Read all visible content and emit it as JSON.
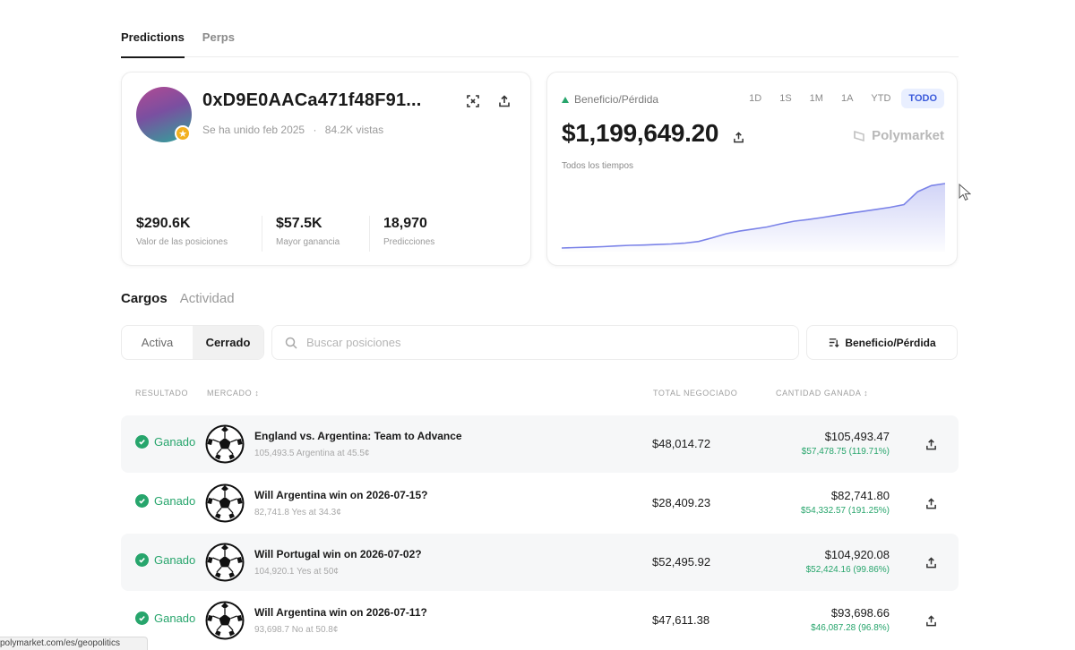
{
  "top_tabs": [
    {
      "label": "Predictions",
      "active": true
    },
    {
      "label": "Perps",
      "active": false
    }
  ],
  "profile": {
    "address": "0xD9E0AACa471f48F91...",
    "joined": "Se ha unido feb 2025",
    "views": "84.2K vistas",
    "stats": [
      {
        "value": "$290.6K",
        "label": "Valor de las posiciones"
      },
      {
        "value": "$57.5K",
        "label": "Mayor ganancia"
      },
      {
        "value": "18,970",
        "label": "Predicciones"
      }
    ]
  },
  "pnl": {
    "label": "Beneficio/Pérdida",
    "value": "$1,199,649.20",
    "period": "Todos los tiempos",
    "brand": "Polymarket",
    "ranges": [
      "1D",
      "1S",
      "1M",
      "1A",
      "YTD",
      "TODO"
    ],
    "active_range": "TODO",
    "series": [
      0,
      0.3,
      0.6,
      1.0,
      1.5,
      2.0,
      2.2,
      2.6,
      3.0,
      3.6,
      4.8,
      7.5,
      10.5,
      12.5,
      14.0,
      15.5,
      17.8,
      19.8,
      21.0,
      22.4,
      24.0,
      25.6,
      27.0,
      28.5,
      30.0,
      32.0,
      41.5,
      46.0,
      47.5
    ]
  },
  "sub_tabs": [
    {
      "label": "Cargos",
      "active": true
    },
    {
      "label": "Actividad",
      "active": false
    }
  ],
  "filter": {
    "active_label": "Activa",
    "closed_label": "Cerrado",
    "search_placeholder": "Buscar posiciones",
    "sort_label": "Beneficio/Pérdida"
  },
  "table": {
    "headers": {
      "result": "RESULTADO",
      "market": "MERCADO",
      "traded": "TOTAL NEGOCIADO",
      "won": "CANTIDAD GANADA"
    },
    "rows": [
      {
        "status": "Ganado",
        "title": "England vs. Argentina: Team to Advance",
        "sub": "105,493.5 Argentina at 45.5¢",
        "traded": "$48,014.72",
        "amount": "$105,493.47",
        "gain": "$57,478.75 (119.71%)"
      },
      {
        "status": "Ganado",
        "title": "Will Argentina win on 2026-07-15?",
        "sub": "82,741.8 Yes at 34.3¢",
        "traded": "$28,409.23",
        "amount": "$82,741.80",
        "gain": "$54,332.57 (191.25%)"
      },
      {
        "status": "Ganado",
        "title": "Will Portugal win on 2026-07-02?",
        "sub": "104,920.1 Yes at 50¢",
        "traded": "$52,495.92",
        "amount": "$104,920.08",
        "gain": "$52,424.16 (99.86%)"
      },
      {
        "status": "Ganado",
        "title": "Will Argentina win on 2026-07-11?",
        "sub": "93,698.7 No at 50.8¢",
        "traded": "$47,611.38",
        "amount": "$93,698.66",
        "gain": "$46,087.28 (96.8%)"
      }
    ]
  },
  "statusbar": {
    "url": "polymarket.com/es/geopolitics"
  },
  "colors": {
    "accent": "#3b5bdb",
    "gain": "#27a56c",
    "chart_line": "#7b83e8"
  }
}
